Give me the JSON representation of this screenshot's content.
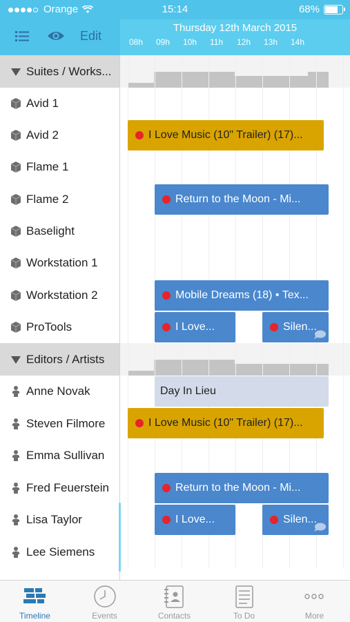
{
  "status_bar": {
    "carrier": "Orange",
    "time": "15:14",
    "battery": "68%"
  },
  "nav": {
    "edit_label": "Edit",
    "date_title": "Thursday 12th March 2015",
    "hours": [
      "08h",
      "09h",
      "10h",
      "11h",
      "12h",
      "13h",
      "14h"
    ]
  },
  "rows": [
    {
      "kind": "group",
      "label": "Suites / Works..."
    },
    {
      "kind": "suite",
      "label": "Avid 1"
    },
    {
      "kind": "suite",
      "label": "Avid 2",
      "event": "I Love Music (10\" Trailer) (17)..."
    },
    {
      "kind": "suite",
      "label": "Flame 1"
    },
    {
      "kind": "suite",
      "label": "Flame 2",
      "event": "Return to the Moon - Mi..."
    },
    {
      "kind": "suite",
      "label": "Baselight"
    },
    {
      "kind": "suite",
      "label": "Workstation 1"
    },
    {
      "kind": "suite",
      "label": "Workstation 2",
      "event": "Mobile Dreams (18) • Tex..."
    },
    {
      "kind": "suite",
      "label": "ProTools",
      "event": "I Love...",
      "event2": "Silen..."
    },
    {
      "kind": "group",
      "label": "Editors / Artists"
    },
    {
      "kind": "person",
      "label": "Anne Novak",
      "event": "Day In Lieu"
    },
    {
      "kind": "person",
      "label": "Steven Filmore",
      "event": "I Love Music (10\" Trailer) (17)..."
    },
    {
      "kind": "person",
      "label": "Emma Sullivan"
    },
    {
      "kind": "person",
      "label": "Fred Feuerstein",
      "event": "Return to the Moon - Mi..."
    },
    {
      "kind": "person",
      "label": "Lisa Taylor",
      "event": "I Love...",
      "event2": "Silen..."
    },
    {
      "kind": "person",
      "label": "Lee Siemens"
    }
  ],
  "tabs": [
    {
      "label": "Timeline",
      "icon": "timeline-icon",
      "active": true
    },
    {
      "label": "Events",
      "icon": "clock-icon"
    },
    {
      "label": "Contacts",
      "icon": "contacts-book-icon"
    },
    {
      "label": "To Do",
      "icon": "todo-list-icon"
    },
    {
      "label": "More",
      "icon": "more-dots-icon"
    }
  ],
  "colors": {
    "header": "#4fc3ea",
    "gold_event": "#d9a400",
    "blue_event": "#4a87cd",
    "pale_event": "#d3dbea",
    "recording_dot": "#e8232a",
    "active_tab": "#2a7ab5"
  }
}
